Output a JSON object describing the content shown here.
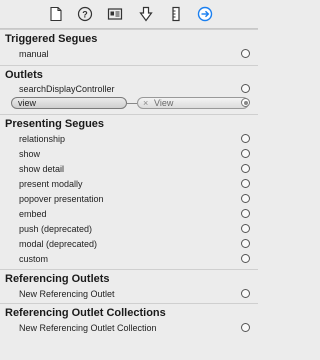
{
  "toolbar": {
    "icons": [
      "file-icon",
      "help-icon",
      "identity-icon",
      "attributes-icon",
      "size-icon",
      "connections-icon"
    ],
    "active_color": "#1a7ff0"
  },
  "triggered_segues": {
    "title": "Triggered Segues",
    "items": [
      {
        "label": "manual"
      }
    ]
  },
  "outlets": {
    "title": "Outlets",
    "items": [
      {
        "label": "searchDisplayController"
      },
      {
        "label": "view",
        "connected_to": "View"
      }
    ]
  },
  "presenting_segues": {
    "title": "Presenting Segues",
    "items": [
      {
        "label": "relationship"
      },
      {
        "label": "show"
      },
      {
        "label": "show detail"
      },
      {
        "label": "present modally"
      },
      {
        "label": "popover presentation"
      },
      {
        "label": "embed"
      },
      {
        "label": "push (deprecated)"
      },
      {
        "label": "modal (deprecated)"
      },
      {
        "label": "custom"
      }
    ]
  },
  "referencing_outlets": {
    "title": "Referencing Outlets",
    "items": [
      {
        "label": "New Referencing Outlet"
      }
    ]
  },
  "referencing_outlet_collections": {
    "title": "Referencing Outlet Collections",
    "items": [
      {
        "label": "New Referencing Outlet Collection"
      }
    ]
  }
}
